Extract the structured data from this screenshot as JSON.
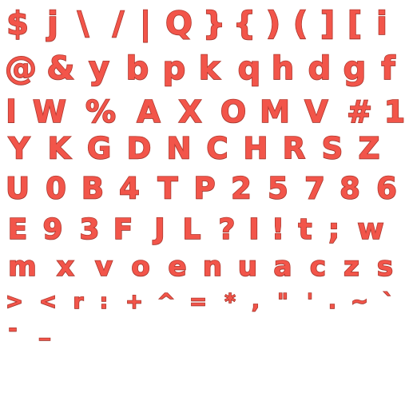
{
  "colors": {
    "fill": "#f2554a",
    "stroke": "#b33a30"
  },
  "rows": [
    [
      "$",
      "j",
      "\\",
      "/",
      "|",
      "Q",
      "}",
      "{",
      ")",
      "(",
      "]",
      "[",
      "i"
    ],
    [
      "@",
      "&",
      "y",
      "b",
      "p",
      "k",
      "q",
      "h",
      "d",
      "g",
      "f"
    ],
    [
      "l",
      "W",
      "%",
      "A",
      "X",
      "O",
      "M",
      "V",
      "#",
      "1"
    ],
    [
      "Y",
      "K",
      "G",
      "D",
      "N",
      "C",
      "H",
      "R",
      "S",
      "Z"
    ],
    [
      "U",
      "0",
      "B",
      "4",
      "T",
      "P",
      "2",
      "5",
      "7",
      "8",
      "6"
    ],
    [
      "E",
      "9",
      "3",
      "F",
      "J",
      "L",
      "?",
      "I",
      "!",
      "t",
      ";",
      "w"
    ],
    [
      "m",
      "x",
      "v",
      "o",
      "e",
      "n",
      "u",
      "a",
      "c",
      "z",
      "s"
    ],
    [
      ">",
      "<",
      "r",
      ":",
      "+",
      "^",
      "=",
      "*",
      ",",
      "\"",
      "'",
      ".",
      "~",
      "`"
    ],
    [
      "-",
      "_"
    ]
  ]
}
